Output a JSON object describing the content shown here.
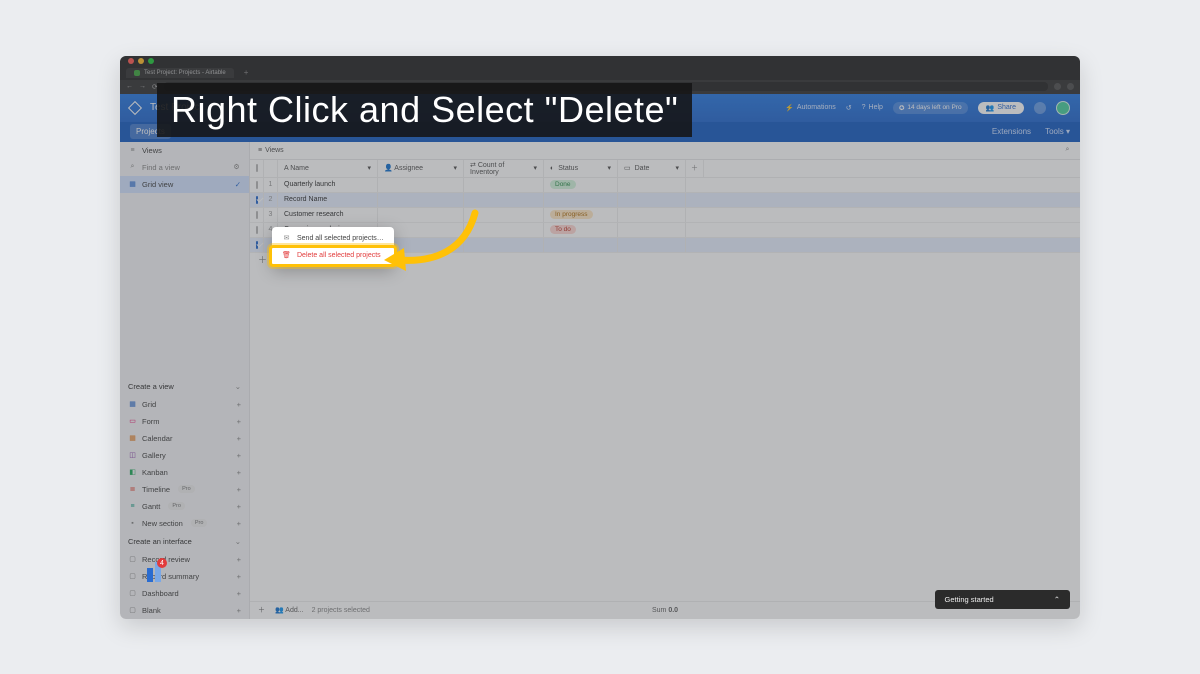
{
  "browser": {
    "tab_title": "Test Project: Projects - Airtable"
  },
  "header": {
    "base_title": "Test Project",
    "automations": "Automations",
    "help": "Help",
    "trial": "14 days left on Pro",
    "share": "Share",
    "extensions": "Extensions",
    "tools": "Tools"
  },
  "subtabs": {
    "projects": "Projects"
  },
  "sidebar": {
    "views_label": "Views",
    "find_placeholder": "Find a view",
    "grid_view": "Grid view",
    "create_view": "Create a view",
    "views": [
      {
        "label": "Grid",
        "color": "blue",
        "glyph": "▦"
      },
      {
        "label": "Form",
        "color": "pink",
        "glyph": "▭"
      },
      {
        "label": "Calendar",
        "color": "orange",
        "glyph": "▦"
      },
      {
        "label": "Gallery",
        "color": "purple",
        "glyph": "◫"
      },
      {
        "label": "Kanban",
        "color": "green",
        "glyph": "◧"
      },
      {
        "label": "Timeline",
        "color": "red",
        "glyph": "≣",
        "pro": true
      },
      {
        "label": "Gantt",
        "color": "teal",
        "glyph": "≡",
        "pro": true
      },
      {
        "label": "New section",
        "color": "gray",
        "glyph": "",
        "pro": true
      }
    ],
    "pro_label": "Pro",
    "create_interface": "Create an interface",
    "interfaces": [
      {
        "label": "Record review"
      },
      {
        "label": "Record summary"
      },
      {
        "label": "Dashboard"
      },
      {
        "label": "Blank"
      }
    ]
  },
  "toolbar": {
    "views": "Views"
  },
  "columns": {
    "name": "Name",
    "assignee": "Assignee",
    "count": "Count of Inventory",
    "status": "Status",
    "date": "Date"
  },
  "rows": [
    {
      "n": "1",
      "name": "Quarterly launch",
      "status": "Done",
      "status_cls": "done",
      "sel": false
    },
    {
      "n": "2",
      "name": "Record Name",
      "status": "",
      "status_cls": "",
      "sel": true
    },
    {
      "n": "3",
      "name": "Customer research",
      "status": "In progress",
      "status_cls": "progress",
      "sel": false
    },
    {
      "n": "4",
      "name": "Campaign analysis",
      "status": "To do",
      "status_cls": "todo",
      "sel": false
    },
    {
      "n": "",
      "name": "",
      "status": "",
      "status_cls": "",
      "sel": true
    }
  ],
  "context_menu": {
    "send": "Send all selected projects…",
    "delete": "Delete all selected projects"
  },
  "footer": {
    "selected": "2 projects selected",
    "add": "Add...",
    "sum_label": "Sum",
    "sum_value": "0.0"
  },
  "getting_started": "Getting started",
  "instruction": "Right Click and Select \"Delete\"",
  "corner_badge": "4"
}
